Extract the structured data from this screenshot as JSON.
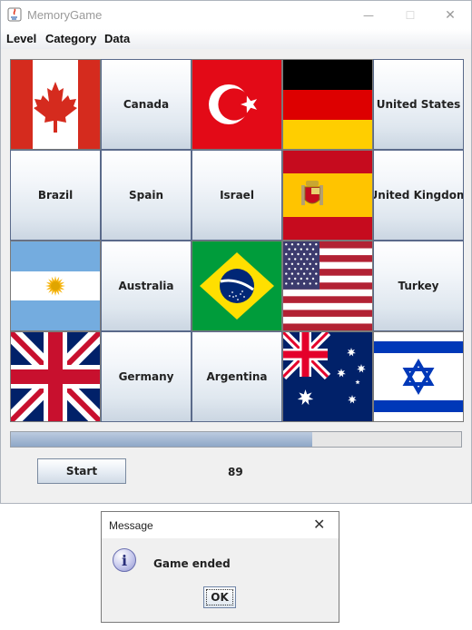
{
  "window": {
    "title": "MemoryGame",
    "controls": {
      "minimize": "—",
      "maximize": "☐",
      "close": "✕"
    }
  },
  "menu": [
    "Level",
    "Category",
    "Data"
  ],
  "grid": [
    {
      "kind": "flag",
      "flag": "canada"
    },
    {
      "kind": "label",
      "label": "Canada"
    },
    {
      "kind": "flag",
      "flag": "turkey"
    },
    {
      "kind": "flag",
      "flag": "germany"
    },
    {
      "kind": "label",
      "label": "United States"
    },
    {
      "kind": "label",
      "label": "Brazil"
    },
    {
      "kind": "label",
      "label": "Spain"
    },
    {
      "kind": "label",
      "label": "Israel"
    },
    {
      "kind": "flag",
      "flag": "spain"
    },
    {
      "kind": "label",
      "label": "United Kingdom"
    },
    {
      "kind": "flag",
      "flag": "argentina"
    },
    {
      "kind": "label",
      "label": "Australia"
    },
    {
      "kind": "flag",
      "flag": "brazil"
    },
    {
      "kind": "flag",
      "flag": "usa"
    },
    {
      "kind": "label",
      "label": "Turkey"
    },
    {
      "kind": "flag",
      "flag": "uk"
    },
    {
      "kind": "label",
      "label": "Germany"
    },
    {
      "kind": "label",
      "label": "Argentina"
    },
    {
      "kind": "flag",
      "flag": "australia"
    },
    {
      "kind": "flag",
      "flag": "israel"
    }
  ],
  "progress": {
    "fraction": 0.67
  },
  "start_label": "Start",
  "score": "89",
  "dialog": {
    "title": "Message",
    "close": "✕",
    "icon": "info-icon",
    "message": "Game ended",
    "ok_label": "OK"
  },
  "colors": {
    "button_border": "#5a6a8a",
    "progress_fill": "#8ea7c7"
  }
}
